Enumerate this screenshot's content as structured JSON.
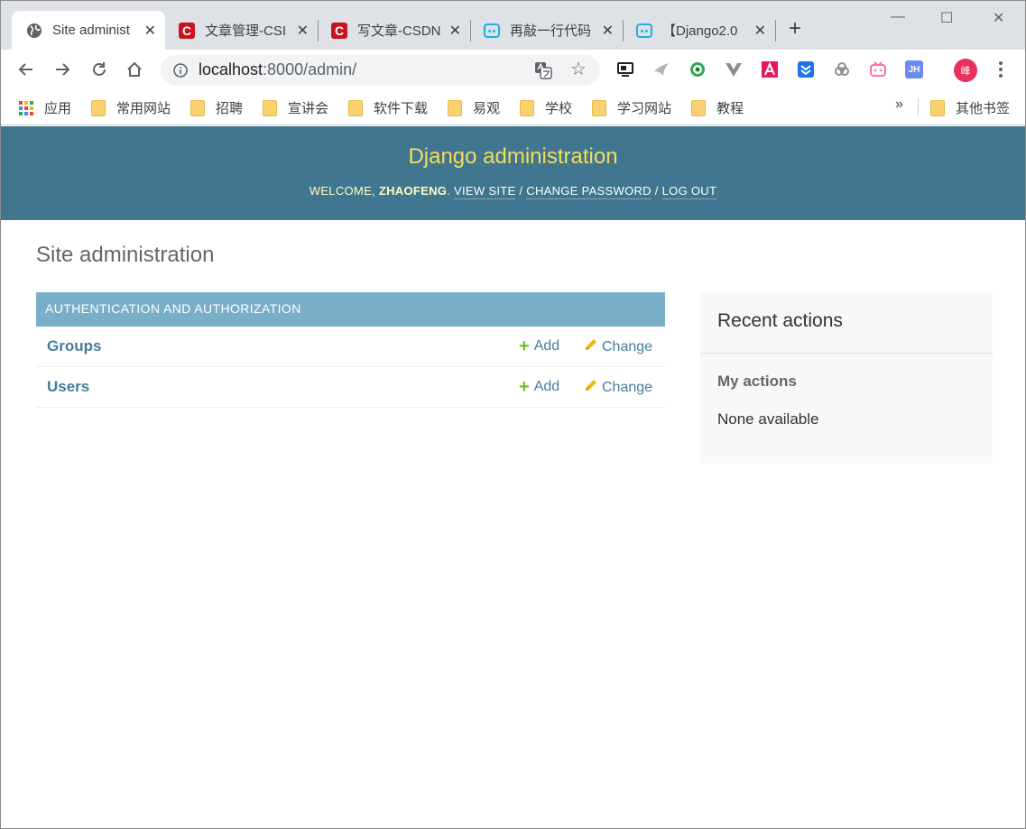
{
  "browser": {
    "tabs": [
      {
        "title": "Site administ",
        "active": true,
        "icon": "globe-icon"
      },
      {
        "title": "文章管理-CSI",
        "active": false,
        "icon": "csdn-icon"
      },
      {
        "title": "写文章-CSDN",
        "active": false,
        "icon": "csdn-icon"
      },
      {
        "title": "再敲一行代码",
        "active": false,
        "icon": "bilibili-icon"
      },
      {
        "title": "【Django2.0",
        "active": false,
        "icon": "bilibili-icon"
      }
    ],
    "csdn_glyph": "C",
    "new_tab_glyph": "+",
    "close_glyph": "✕",
    "window_controls": {
      "minimize": "—",
      "maximize": "☐",
      "close": "✕"
    },
    "address": {
      "host": "localhost",
      "rest": ":8000/admin/"
    },
    "star_glyph": "☆",
    "extensions": [
      {
        "name": "screen-capture-icon",
        "color": "#202124",
        "label": ""
      },
      {
        "name": "bird-extension-icon",
        "color": "#9aa0a6",
        "label": ""
      },
      {
        "name": "eye-extension-icon",
        "color": "#34a853",
        "label": ""
      },
      {
        "name": "vue-devtools-icon",
        "color": "#8a8f94",
        "label": ""
      },
      {
        "name": "angular-icon",
        "color": "#e8175d",
        "label": ""
      },
      {
        "name": "download-extension-icon",
        "color": "#1a73e8",
        "label": ""
      },
      {
        "name": "link-extension-icon",
        "color": "#9aa0a6",
        "label": ""
      },
      {
        "name": "bilibili-extension-icon",
        "color": "#fb7299",
        "label": ""
      },
      {
        "name": "jh-extension-icon",
        "color": "#6b8af2",
        "label": "JH"
      }
    ],
    "profile_initial": "峰",
    "bookmarks": [
      {
        "label": "应用",
        "type": "apps"
      },
      {
        "label": "常用网站",
        "type": "folder"
      },
      {
        "label": "招聘",
        "type": "folder"
      },
      {
        "label": "宣讲会",
        "type": "folder"
      },
      {
        "label": "软件下载",
        "type": "folder"
      },
      {
        "label": "易观",
        "type": "folder"
      },
      {
        "label": "学校",
        "type": "folder"
      },
      {
        "label": "学习网站",
        "type": "folder"
      },
      {
        "label": "教程",
        "type": "folder"
      }
    ],
    "bookmarks_more": "»",
    "other_bookmarks": "其他书签"
  },
  "admin": {
    "branding": "Django administration",
    "user_tools": {
      "welcome": "WELCOME,",
      "username": "ZHAOFENG",
      "view_site": "VIEW SITE",
      "change_password": "CHANGE PASSWORD",
      "log_out": "LOG OUT",
      "separator": "/"
    },
    "page_title": "Site administration",
    "app_module": {
      "caption": "AUTHENTICATION AND AUTHORIZATION",
      "models": [
        {
          "name": "Groups",
          "add": "Add",
          "change": "Change"
        },
        {
          "name": "Users",
          "add": "Add",
          "change": "Change"
        }
      ]
    },
    "recent_actions": {
      "title": "Recent actions",
      "subtitle": "My actions",
      "empty": "None available"
    },
    "colors": {
      "header_bg": "#417690",
      "branding": "#f5dd5d",
      "caption_bg": "#79aec8",
      "link": "#447e9b",
      "add_icon": "#70bf2b",
      "change_icon": "#efb80b"
    }
  }
}
